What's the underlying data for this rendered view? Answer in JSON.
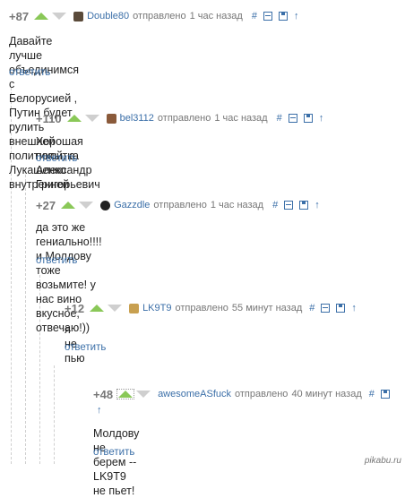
{
  "comments": [
    {
      "rating": "+87",
      "author": "Double80",
      "posted": "отправлено",
      "time": "1 час назад",
      "lines": [
        "Давайте лучше объединимся с Белорусией , Путин будет рулить внешней",
        "политикой, а Лукашенко внутренней"
      ],
      "reply": "ответить",
      "avatar_color": "#5a4a3a"
    },
    {
      "rating": "+110",
      "author": "bel3112",
      "posted": "отправлено",
      "time": "1 час назад",
      "lines": [
        "Хорошая попытка Александр Григорьевич"
      ],
      "reply": "ответить",
      "avatar_color": "#8a5a3a"
    },
    {
      "rating": "+27",
      "author": "Gazzdle",
      "posted": "отправлено",
      "time": "1 час назад",
      "lines": [
        "да это же гениально!!!!",
        "и Молдову тоже возьмите! у нас вино вкусное, отвечаю!))"
      ],
      "reply": "ответить",
      "avatar_color": "#222222"
    },
    {
      "rating": "+12",
      "author": "LK9T9",
      "posted": "отправлено",
      "time": "55 минут назад",
      "lines": [
        "я не пью"
      ],
      "reply": "ответить",
      "avatar_color": "#c8a050"
    },
    {
      "rating": "+48",
      "author": "awesomeASfuck",
      "posted": "отправлено",
      "time": "40 минут назад",
      "lines": [
        "Молдову не берем -- LK9T9 не пьет!"
      ],
      "reply": "ответить"
    }
  ],
  "tool_icons": {
    "link": "#",
    "collapse": "minus-box-icon",
    "save": "save-icon",
    "parent": "↑"
  },
  "watermark": "pikabu.ru",
  "colors": {
    "link": "#3b6fa8",
    "up": "#8ac858",
    "down": "#cfcfcf"
  }
}
